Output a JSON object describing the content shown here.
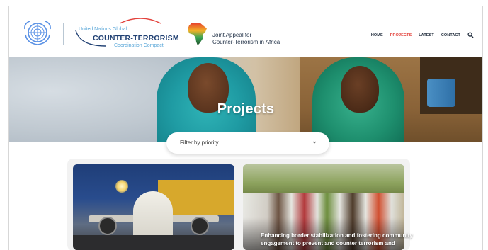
{
  "header": {
    "ctcc": {
      "line1": "United Nations Global",
      "line2": "COUNTER-TERRORISM",
      "line3": "Coordination Compact"
    },
    "joint_appeal": {
      "line1": "Joint Appeal for",
      "line2": "Counter-Terrorism in Africa"
    },
    "nav": [
      {
        "label": "HOME",
        "active": false
      },
      {
        "label": "PROJECTS",
        "active": true
      },
      {
        "label": "LATEST",
        "active": false
      },
      {
        "label": "CONTACT",
        "active": false
      }
    ],
    "search_icon": "search-icon",
    "colors": {
      "active_nav": "#e3413b",
      "nav": "#1e2a3a",
      "brand_blue": "#58a6d8",
      "brand_navy": "#1f3f72"
    }
  },
  "hero": {
    "title": "Projects"
  },
  "filter": {
    "label": "Filter by priority",
    "icon": "chevron-down-icon"
  },
  "cards": [
    {
      "title_lines": []
    },
    {
      "title_lines": [
        "Enhancing border stabilization and fostering community",
        "engagement to prevent and counter terrorism and"
      ]
    }
  ]
}
